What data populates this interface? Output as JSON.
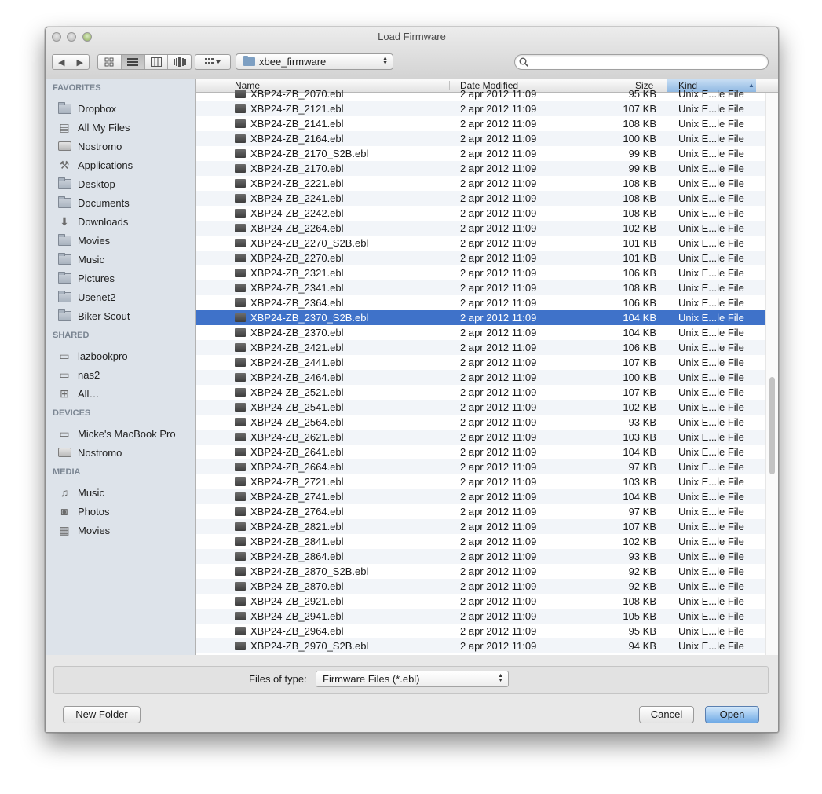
{
  "window": {
    "title": "Load Firmware"
  },
  "toolbar": {
    "folder": "xbee_firmware",
    "search_placeholder": "",
    "nav": {
      "back": "◀",
      "forward": "▶"
    }
  },
  "sidebar": {
    "favorites_heading": "FAVORITES",
    "favorites": [
      {
        "label": "Dropbox",
        "icon": "folder-icon"
      },
      {
        "label": "All My Files",
        "icon": "all-files-icon"
      },
      {
        "label": "Nostromo",
        "icon": "drive-icon"
      },
      {
        "label": "Applications",
        "icon": "applications-icon"
      },
      {
        "label": "Desktop",
        "icon": "folder-icon"
      },
      {
        "label": "Documents",
        "icon": "folder-icon"
      },
      {
        "label": "Downloads",
        "icon": "downloads-icon"
      },
      {
        "label": "Movies",
        "icon": "folder-icon"
      },
      {
        "label": "Music",
        "icon": "folder-icon"
      },
      {
        "label": "Pictures",
        "icon": "folder-icon"
      },
      {
        "label": "Usenet2",
        "icon": "folder-icon"
      },
      {
        "label": "Biker Scout",
        "icon": "folder-icon"
      }
    ],
    "shared_heading": "SHARED",
    "shared": [
      {
        "label": "lazbookpro",
        "icon": "laptop-icon"
      },
      {
        "label": "nas2",
        "icon": "monitor-icon"
      },
      {
        "label": "All…",
        "icon": "network-icon"
      }
    ],
    "devices_heading": "DEVICES",
    "devices": [
      {
        "label": "Micke's MacBook Pro",
        "icon": "laptop-icon"
      },
      {
        "label": "Nostromo",
        "icon": "drive-icon"
      }
    ],
    "media_heading": "MEDIA",
    "media": [
      {
        "label": "Music",
        "icon": "music-icon"
      },
      {
        "label": "Photos",
        "icon": "camera-icon"
      },
      {
        "label": "Movies",
        "icon": "film-icon"
      }
    ]
  },
  "columns": {
    "name": "Name",
    "date": "Date Modified",
    "size": "Size",
    "kind": "Kind"
  },
  "files": [
    {
      "name": "XBP24-ZB_2070.ebl",
      "date": "2 apr 2012 11:09",
      "size": "95 KB",
      "kind": "Unix E...le File"
    },
    {
      "name": "XBP24-ZB_2121.ebl",
      "date": "2 apr 2012 11:09",
      "size": "107 KB",
      "kind": "Unix E...le File"
    },
    {
      "name": "XBP24-ZB_2141.ebl",
      "date": "2 apr 2012 11:09",
      "size": "108 KB",
      "kind": "Unix E...le File"
    },
    {
      "name": "XBP24-ZB_2164.ebl",
      "date": "2 apr 2012 11:09",
      "size": "100 KB",
      "kind": "Unix E...le File"
    },
    {
      "name": "XBP24-ZB_2170_S2B.ebl",
      "date": "2 apr 2012 11:09",
      "size": "99 KB",
      "kind": "Unix E...le File"
    },
    {
      "name": "XBP24-ZB_2170.ebl",
      "date": "2 apr 2012 11:09",
      "size": "99 KB",
      "kind": "Unix E...le File"
    },
    {
      "name": "XBP24-ZB_2221.ebl",
      "date": "2 apr 2012 11:09",
      "size": "108 KB",
      "kind": "Unix E...le File"
    },
    {
      "name": "XBP24-ZB_2241.ebl",
      "date": "2 apr 2012 11:09",
      "size": "108 KB",
      "kind": "Unix E...le File"
    },
    {
      "name": "XBP24-ZB_2242.ebl",
      "date": "2 apr 2012 11:09",
      "size": "108 KB",
      "kind": "Unix E...le File"
    },
    {
      "name": "XBP24-ZB_2264.ebl",
      "date": "2 apr 2012 11:09",
      "size": "102 KB",
      "kind": "Unix E...le File"
    },
    {
      "name": "XBP24-ZB_2270_S2B.ebl",
      "date": "2 apr 2012 11:09",
      "size": "101 KB",
      "kind": "Unix E...le File"
    },
    {
      "name": "XBP24-ZB_2270.ebl",
      "date": "2 apr 2012 11:09",
      "size": "101 KB",
      "kind": "Unix E...le File"
    },
    {
      "name": "XBP24-ZB_2321.ebl",
      "date": "2 apr 2012 11:09",
      "size": "106 KB",
      "kind": "Unix E...le File"
    },
    {
      "name": "XBP24-ZB_2341.ebl",
      "date": "2 apr 2012 11:09",
      "size": "108 KB",
      "kind": "Unix E...le File"
    },
    {
      "name": "XBP24-ZB_2364.ebl",
      "date": "2 apr 2012 11:09",
      "size": "106 KB",
      "kind": "Unix E...le File"
    },
    {
      "name": "XBP24-ZB_2370_S2B.ebl",
      "date": "2 apr 2012 11:09",
      "size": "104 KB",
      "kind": "Unix E...le File",
      "selected": true
    },
    {
      "name": "XBP24-ZB_2370.ebl",
      "date": "2 apr 2012 11:09",
      "size": "104 KB",
      "kind": "Unix E...le File"
    },
    {
      "name": "XBP24-ZB_2421.ebl",
      "date": "2 apr 2012 11:09",
      "size": "106 KB",
      "kind": "Unix E...le File"
    },
    {
      "name": "XBP24-ZB_2441.ebl",
      "date": "2 apr 2012 11:09",
      "size": "107 KB",
      "kind": "Unix E...le File"
    },
    {
      "name": "XBP24-ZB_2464.ebl",
      "date": "2 apr 2012 11:09",
      "size": "100 KB",
      "kind": "Unix E...le File"
    },
    {
      "name": "XBP24-ZB_2521.ebl",
      "date": "2 apr 2012 11:09",
      "size": "107 KB",
      "kind": "Unix E...le File"
    },
    {
      "name": "XBP24-ZB_2541.ebl",
      "date": "2 apr 2012 11:09",
      "size": "102 KB",
      "kind": "Unix E...le File"
    },
    {
      "name": "XBP24-ZB_2564.ebl",
      "date": "2 apr 2012 11:09",
      "size": "93 KB",
      "kind": "Unix E...le File"
    },
    {
      "name": "XBP24-ZB_2621.ebl",
      "date": "2 apr 2012 11:09",
      "size": "103 KB",
      "kind": "Unix E...le File"
    },
    {
      "name": "XBP24-ZB_2641.ebl",
      "date": "2 apr 2012 11:09",
      "size": "104 KB",
      "kind": "Unix E...le File"
    },
    {
      "name": "XBP24-ZB_2664.ebl",
      "date": "2 apr 2012 11:09",
      "size": "97 KB",
      "kind": "Unix E...le File"
    },
    {
      "name": "XBP24-ZB_2721.ebl",
      "date": "2 apr 2012 11:09",
      "size": "103 KB",
      "kind": "Unix E...le File"
    },
    {
      "name": "XBP24-ZB_2741.ebl",
      "date": "2 apr 2012 11:09",
      "size": "104 KB",
      "kind": "Unix E...le File"
    },
    {
      "name": "XBP24-ZB_2764.ebl",
      "date": "2 apr 2012 11:09",
      "size": "97 KB",
      "kind": "Unix E...le File"
    },
    {
      "name": "XBP24-ZB_2821.ebl",
      "date": "2 apr 2012 11:09",
      "size": "107 KB",
      "kind": "Unix E...le File"
    },
    {
      "name": "XBP24-ZB_2841.ebl",
      "date": "2 apr 2012 11:09",
      "size": "102 KB",
      "kind": "Unix E...le File"
    },
    {
      "name": "XBP24-ZB_2864.ebl",
      "date": "2 apr 2012 11:09",
      "size": "93 KB",
      "kind": "Unix E...le File"
    },
    {
      "name": "XBP24-ZB_2870_S2B.ebl",
      "date": "2 apr 2012 11:09",
      "size": "92 KB",
      "kind": "Unix E...le File"
    },
    {
      "name": "XBP24-ZB_2870.ebl",
      "date": "2 apr 2012 11:09",
      "size": "92 KB",
      "kind": "Unix E...le File"
    },
    {
      "name": "XBP24-ZB_2921.ebl",
      "date": "2 apr 2012 11:09",
      "size": "108 KB",
      "kind": "Unix E...le File"
    },
    {
      "name": "XBP24-ZB_2941.ebl",
      "date": "2 apr 2012 11:09",
      "size": "105 KB",
      "kind": "Unix E...le File"
    },
    {
      "name": "XBP24-ZB_2964.ebl",
      "date": "2 apr 2012 11:09",
      "size": "95 KB",
      "kind": "Unix E...le File"
    },
    {
      "name": "XBP24-ZB_2970_S2B.ebl",
      "date": "2 apr 2012 11:09",
      "size": "94 KB",
      "kind": "Unix E...le File"
    }
  ],
  "footer": {
    "files_of_type_label": "Files of type:",
    "files_of_type_value": "Firmware Files (*.ebl)",
    "new_folder": "New Folder",
    "cancel": "Cancel",
    "open": "Open"
  },
  "colors": {
    "selection": "#3f72c9",
    "sidebar": "#dde3ea",
    "default_button": "#6fa9e5"
  }
}
